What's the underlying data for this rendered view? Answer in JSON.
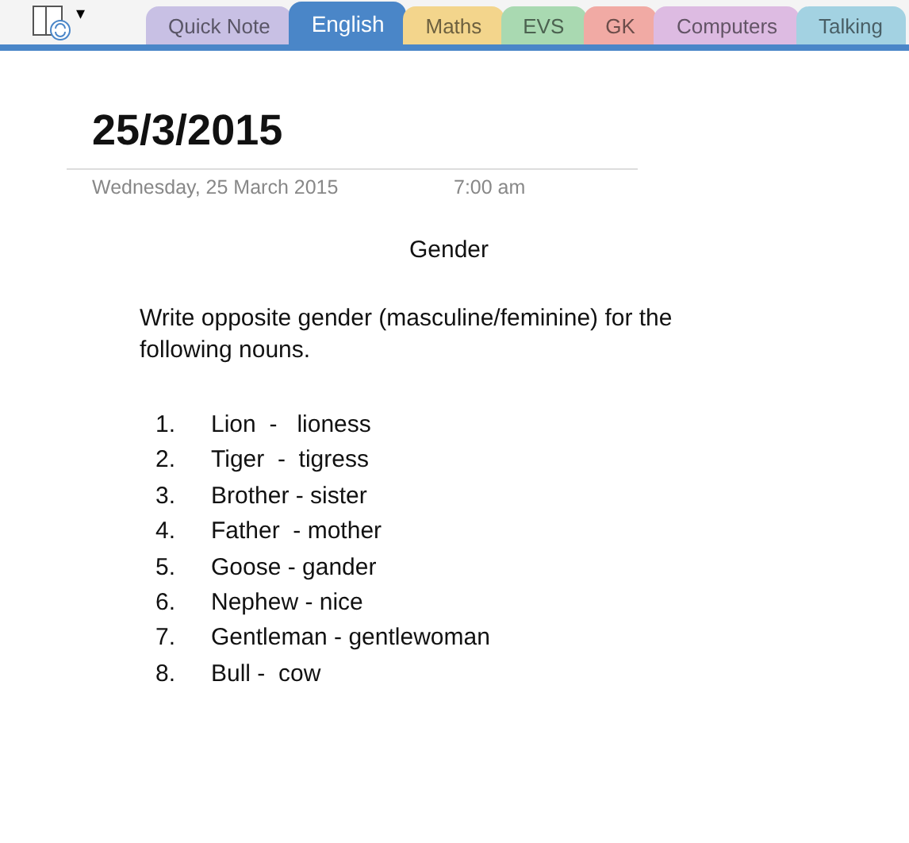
{
  "toolbar": {
    "notebook_menu": "▾"
  },
  "tabs": [
    {
      "label": "Quick Note",
      "selected": false,
      "color": "#c8c0e4"
    },
    {
      "label": "English",
      "selected": true,
      "color": "#4a86c8"
    },
    {
      "label": "Maths",
      "selected": false,
      "color": "#f3d58c"
    },
    {
      "label": "EVS",
      "selected": false,
      "color": "#a9d9b1"
    },
    {
      "label": "GK",
      "selected": false,
      "color": "#f1aaa4"
    },
    {
      "label": "Computers",
      "selected": false,
      "color": "#ddbbe2"
    },
    {
      "label": "Talking",
      "selected": false,
      "color": "#a3d2e2"
    }
  ],
  "page": {
    "title": "25/3/2015",
    "date": "Wednesday, 25 March 2015",
    "time": "7:00 am",
    "heading": "Gender",
    "instruction": "Write opposite gender (masculine/feminine) for the following nouns.",
    "items": [
      {
        "number": "1.",
        "text": "Lion  -   lioness"
      },
      {
        "number": "2.",
        "text": "Tiger  -  tigress"
      },
      {
        "number": "3.",
        "text": "Brother - sister"
      },
      {
        "number": "4.",
        "text": "Father  - mother"
      },
      {
        "number": "5.",
        "text": "Goose - gander"
      },
      {
        "number": "6.",
        "text": "Nephew - nice"
      },
      {
        "number": "7.",
        "text": "Gentleman - gentlewoman"
      },
      {
        "number": "8.",
        "text": "Bull -  cow"
      }
    ]
  }
}
